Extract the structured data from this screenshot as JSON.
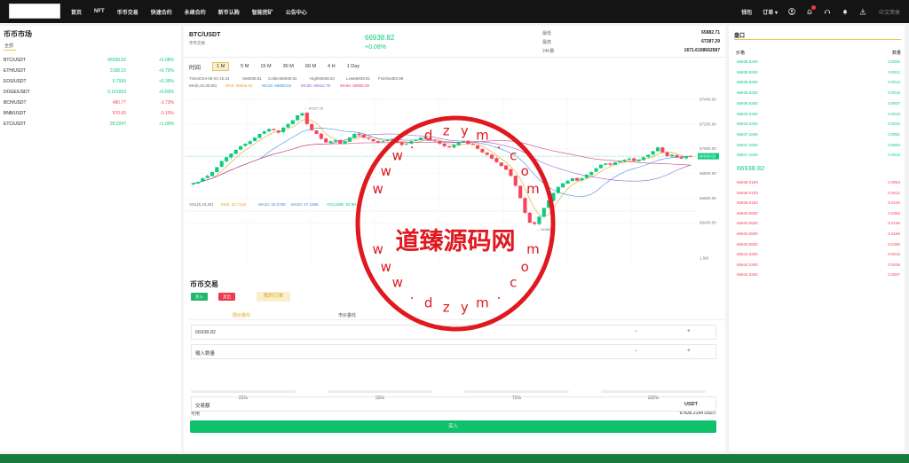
{
  "nav": {
    "links": [
      "首页",
      "NFT",
      "币币交易",
      "快速合约",
      "永续合约",
      "新币认购",
      "智能挖矿",
      "公告中心"
    ],
    "wallet": "钱包",
    "orders": "订单",
    "language": "中文简体"
  },
  "market": {
    "title": "币币市场",
    "tab_all": "全部",
    "rows": [
      {
        "symbol": "BTC/USDT",
        "price": "66938.82",
        "change": "+0.08%",
        "dir": "up"
      },
      {
        "symbol": "ETH/USDT",
        "price": "3188.15",
        "change": "+0.79%",
        "dir": "up"
      },
      {
        "symbol": "EOS/USDT",
        "price": "0.7930",
        "change": "+0.35%",
        "dir": "up"
      },
      {
        "symbol": "DOGE/USDT",
        "price": "0.161653",
        "change": "+0.83%",
        "dir": "up"
      },
      {
        "symbol": "BCH/USDT",
        "price": "480.77",
        "change": "-3.73%",
        "dir": "down"
      },
      {
        "symbol": "BNB/USDT",
        "price": "570.65",
        "change": "-0.10%",
        "dir": "down"
      },
      {
        "symbol": "ETC/USDT",
        "price": "28.0247",
        "change": "+1.09%",
        "dir": "up"
      }
    ]
  },
  "ticker": {
    "pair": "BTC/USDT",
    "pair_sub": "币币交易",
    "last_price": "66938.82",
    "change": "+0.08%",
    "stats": [
      {
        "label": "最低",
        "value": "65882.71"
      },
      {
        "label": "最高",
        "value": "67287.29"
      },
      {
        "label": "24h量",
        "value": "1671.6158562587"
      }
    ]
  },
  "timeframes": [
    "时间",
    "1 M",
    "5 M",
    "15 M",
    "30 M",
    "60 M",
    "4 H",
    "1 Day"
  ],
  "active_timeframe": "1 M",
  "chart_data": {
    "type": "candlestick",
    "ohlc_legend": {
      "time": "Time2024-05-20 16:24",
      "open": "S66938.81",
      "close": "Collect66938.82",
      "high": "High66938.82",
      "low": "Low66938.81",
      "finished": "Finished83.99"
    },
    "ma_legend": {
      "label": "MA(5,10,30,60)",
      "ma5": "MA5: 66926.22",
      "ma15": "MA15: 66908.53",
      "ma30": "MA30: 66912.79",
      "ma60": "MA60: 66855.00"
    },
    "vol_legend": {
      "label": "VOL(5,10,20)",
      "ma5": "MA5: 32.741K",
      "ma10": "MA10: 32.578K",
      "ma20": "MA20: 47.159K",
      "volume": "VOLUME: 83.99"
    },
    "y_ticks": [
      "67400.00",
      "67200.00",
      "67000.00",
      "66800.00",
      "66600.00",
      "66400.00"
    ],
    "y_range": [
      66300,
      67450
    ],
    "vol_ticks": [
      "1.5M",
      "900K",
      "300K"
    ],
    "x_ticks": [
      "12:55",
      "13:25",
      "13:55",
      "14:25",
      "14:55",
      "15:25",
      "15:55"
    ],
    "current_price_tag": "66938.82",
    "high_marker": "67287.29",
    "low_marker": "66380.20",
    "close_series": [
      66720,
      66730,
      66760,
      66780,
      66810,
      66850,
      66900,
      66930,
      66960,
      66990,
      67020,
      67040,
      67060,
      67090,
      67120,
      67140,
      67160,
      67150,
      67130,
      67170,
      67200,
      67230,
      67270,
      67287,
      67200,
      67150,
      67120,
      67080,
      67050,
      67060,
      67070,
      67040,
      67060,
      67090,
      67120,
      67110,
      67090,
      67080,
      67060,
      67050,
      67060,
      67070,
      67080,
      67050,
      67030,
      67040,
      67060,
      67070,
      67090,
      67080,
      67070,
      67060,
      67040,
      67020,
      67010,
      67030,
      67050,
      67060,
      67040,
      67030,
      67000,
      66970,
      66950,
      66920,
      66890,
      66860,
      66830,
      66780,
      66700,
      66600,
      66480,
      66400,
      66390,
      66450,
      66520,
      66580,
      66640,
      66690,
      66720,
      66740,
      66760,
      66740,
      66760,
      66790,
      66810,
      66840,
      66870,
      66880,
      66870,
      66890,
      66900,
      66910,
      66920,
      66900,
      66910,
      66930,
      66950,
      66980,
      67010,
      66970,
      66940,
      66950,
      66930,
      66920,
      66940,
      66938
    ]
  },
  "trade": {
    "title": "币币交易",
    "buy_tab": "买入",
    "sell_tab": "卖出",
    "my_orders": "我的订单",
    "limit_tab": "限价委托",
    "market_tab": "市价委托",
    "price_value": "66938.82",
    "amount_placeholder": "输入数量",
    "minus": "−",
    "plus": "+",
    "percents": [
      "25%",
      "50%",
      "75%",
      "100%"
    ],
    "available_label": "可用",
    "available_value": "67836.2194 USDT",
    "turnover_label": "交易额",
    "turnover_unit": "USDT",
    "submit": "买入"
  },
  "orderbook": {
    "title": "盘口",
    "price_header": "价格",
    "qty_header": "数量",
    "bids": [
      {
        "price": "66938.8200",
        "qty": "0.0045"
      },
      {
        "price": "66938.8200",
        "qty": "0.0012"
      },
      {
        "price": "66938.8200",
        "qty": "0.0014"
      },
      {
        "price": "66938.8200",
        "qty": "0.0015"
      },
      {
        "price": "66938.8200",
        "qty": "0.0007"
      },
      {
        "price": "66944.0400",
        "qty": "0.0013"
      },
      {
        "price": "66944.0400",
        "qty": "0.0034"
      },
      {
        "price": "66947.1600",
        "qty": "0.0051"
      },
      {
        "price": "66947.1600",
        "qty": "0.0053"
      },
      {
        "price": "66947.1600",
        "qty": "0.0013"
      }
    ],
    "mid_price": "66938.82",
    "asks": [
      {
        "price": "66938.0100",
        "qty": "0.0063"
      },
      {
        "price": "66938.0100",
        "qty": "0.0012"
      },
      {
        "price": "66938.0100",
        "qty": "0.0130"
      },
      {
        "price": "66940.0600",
        "qty": "0.0382"
      },
      {
        "price": "66940.0600",
        "qty": "0.0165"
      },
      {
        "price": "66940.0600",
        "qty": "0.0165"
      },
      {
        "price": "66940.0600",
        "qty": "0.0280"
      },
      {
        "price": "66944.0300",
        "qty": "0.0016"
      },
      {
        "price": "66944.0300",
        "qty": "0.0036"
      },
      {
        "price": "66944.0300",
        "qty": "0.0007"
      }
    ]
  },
  "watermark": {
    "center_text": "道臻源码网",
    "ring_text": "www.dzym.com"
  },
  "colors": {
    "up": "#0ecb81",
    "down": "#f6465d",
    "accent": "#e8c547",
    "nav_bg": "#141414",
    "stamp": "#e0181f"
  }
}
